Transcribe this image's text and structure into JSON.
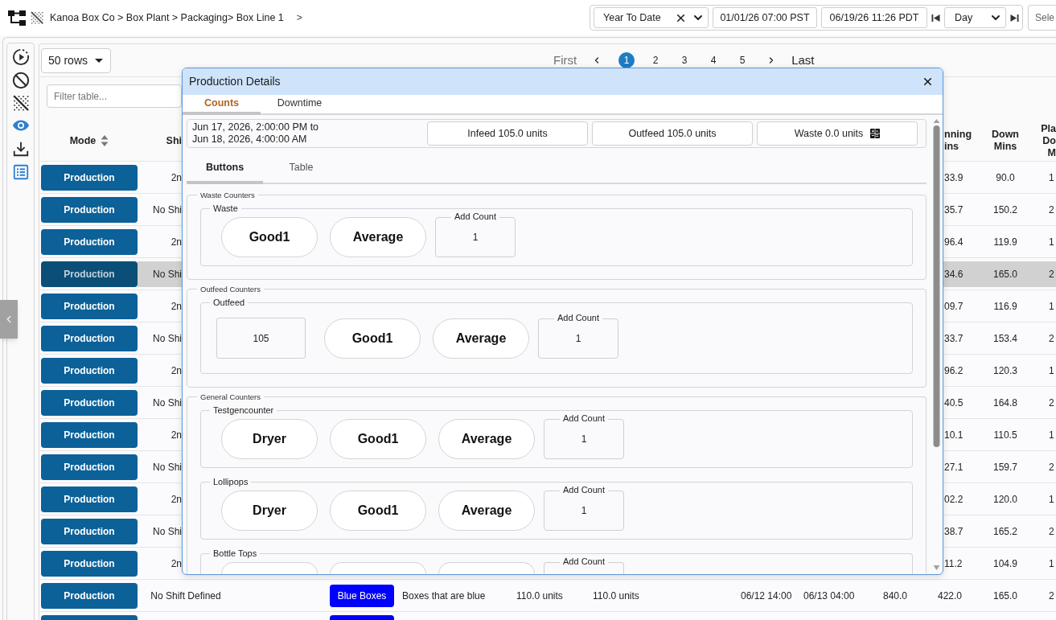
{
  "top_bar": {
    "breadcrumb": "Kanoa Box Co > Box Plant > Packaging> Box Line 1",
    "breadcrumb_next": ">",
    "range_select": "Year To Date",
    "start_time": "01/01/26 07:00 PST",
    "end_time": "06/19/26 11:26 PDT",
    "interval_select": "Day",
    "select_field": {
      "placeholder": "Sele"
    }
  },
  "toolbar": [
    {
      "active": false
    },
    {
      "active": false
    },
    {
      "active": false
    },
    {
      "active": true
    },
    {
      "active": false
    },
    {
      "active": true
    }
  ],
  "rows_select": "50 rows",
  "pagination": {
    "first": {
      "label": "First",
      "disabled": true
    },
    "pages": [
      {
        "label": "1",
        "selected": true
      },
      {
        "label": "2",
        "selected": false
      },
      {
        "label": "3",
        "selected": false
      },
      {
        "label": "4",
        "selected": false
      },
      {
        "label": "5",
        "selected": false
      }
    ],
    "last": {
      "label": "Last",
      "disabled": false
    }
  },
  "filter": {
    "placeholder": "Filter table..."
  },
  "table": {
    "columns": [
      {
        "label": "Mode",
        "sortable": true
      },
      {
        "label": "Shi",
        "sortable": false
      },
      {
        "label": "nning\nins",
        "sortable": false
      },
      {
        "label": "Down\nMins",
        "sortable": false
      },
      {
        "label": "Pla\nDo\nM",
        "sortable": false
      }
    ],
    "rows": [
      {
        "kind": "partial",
        "selected": false,
        "mode": "Production",
        "shift": "2n",
        "values": [
          "33.9",
          "90.0",
          "1"
        ]
      },
      {
        "kind": "partial",
        "selected": false,
        "mode": "Production",
        "shift": "No Shi",
        "values": [
          "35.7",
          "150.2",
          "2"
        ]
      },
      {
        "kind": "partial",
        "selected": false,
        "mode": "Production",
        "shift": "2n",
        "values": [
          "96.4",
          "119.9",
          "1"
        ]
      },
      {
        "kind": "partial",
        "selected": true,
        "mode": "Production",
        "shift": "No Shi",
        "values": [
          "34.6",
          "165.0",
          "2"
        ]
      },
      {
        "kind": "partial",
        "selected": false,
        "mode": "Production",
        "shift": "2n",
        "values": [
          "09.7",
          "116.9",
          "1"
        ]
      },
      {
        "kind": "partial",
        "selected": false,
        "mode": "Production",
        "shift": "No Shi",
        "values": [
          "33.7",
          "153.4",
          "2"
        ]
      },
      {
        "kind": "partial",
        "selected": false,
        "mode": "Production",
        "shift": "2n",
        "values": [
          "96.2",
          "120.3",
          "1"
        ]
      },
      {
        "kind": "partial",
        "selected": false,
        "mode": "Production",
        "shift": "No Shi",
        "values": [
          "40.5",
          "164.8",
          "2"
        ]
      },
      {
        "kind": "partial",
        "selected": false,
        "mode": "Production",
        "shift": "2n",
        "values": [
          "10.1",
          "110.5",
          "1"
        ]
      },
      {
        "kind": "partial",
        "selected": false,
        "mode": "Production",
        "shift": "No Shi",
        "values": [
          "27.1",
          "159.7",
          "2"
        ]
      },
      {
        "kind": "partial",
        "selected": false,
        "mode": "Production",
        "shift": "2n",
        "values": [
          "02.2",
          "120.0",
          "1"
        ]
      },
      {
        "kind": "partial",
        "selected": false,
        "mode": "Production",
        "shift": "No Shi",
        "values": [
          "38.7",
          "165.2",
          "2"
        ]
      },
      {
        "kind": "partial",
        "selected": false,
        "mode": "Production",
        "shift": "2n",
        "values": [
          "11.2",
          "104.9",
          "1"
        ]
      },
      {
        "kind": "full",
        "selected": false,
        "mode": "Production",
        "shift": "No Shift Defined",
        "tag": {
          "label": "Blue Boxes",
          "color": "#0000ff"
        },
        "values": [
          "Boxes that are blue",
          "110.0 units",
          "110.0 units",
          "06/12 14:00",
          "06/13 04:00",
          "840.0",
          "422.0",
          "165.0",
          "2"
        ]
      },
      {
        "kind": "cut",
        "selected": false,
        "tag": {
          "color": "#0000ff"
        }
      }
    ]
  },
  "dialog": {
    "title": "Production Details",
    "tabs": [
      {
        "label": "Counts",
        "selected": true
      },
      {
        "label": "Downtime",
        "selected": false
      }
    ],
    "summary": {
      "range": [
        "Jun 17, 2026, 2:00:00 PM to",
        "Jun 18, 2026, 4:00:00 AM"
      ],
      "totals": [
        {
          "label": "Infeed 105.0 units",
          "kind": "plain"
        },
        {
          "label": "Outfeed 105.0 units",
          "kind": "plain"
        },
        {
          "label": "Waste 0.0 units",
          "kind": "adjustable"
        }
      ]
    },
    "subtabs": [
      {
        "label": "Buttons",
        "selected": true
      },
      {
        "label": "Table",
        "selected": false
      }
    ],
    "sections": [
      {
        "title": "Waste Counters",
        "groups": [
          {
            "title": "Waste",
            "clipped": false,
            "items": [
              {
                "kind": "pill",
                "label": "Good1"
              },
              {
                "kind": "pill",
                "label": "Average"
              },
              {
                "kind": "add_count",
                "legend": "Add Count",
                "value": "1"
              }
            ]
          }
        ]
      },
      {
        "title": "Outfeed Counters",
        "groups": [
          {
            "title": "Outfeed",
            "clipped": false,
            "items": [
              {
                "kind": "display",
                "value": "105"
              },
              {
                "kind": "pill",
                "label": "Good1"
              },
              {
                "kind": "pill",
                "label": "Average"
              },
              {
                "kind": "add_count",
                "legend": "Add Count",
                "value": "1"
              }
            ]
          }
        ]
      },
      {
        "title": "General Counters",
        "groups": [
          {
            "title": "Testgencounter",
            "clipped": false,
            "items": [
              {
                "kind": "pill",
                "label": "Dryer"
              },
              {
                "kind": "pill",
                "label": "Good1"
              },
              {
                "kind": "pill",
                "label": "Average"
              },
              {
                "kind": "add_count",
                "legend": "Add Count",
                "value": "1"
              }
            ]
          },
          {
            "title": "Lollipops",
            "clipped": false,
            "items": [
              {
                "kind": "pill",
                "label": "Dryer"
              },
              {
                "kind": "pill",
                "label": "Good1"
              },
              {
                "kind": "pill",
                "label": "Average"
              },
              {
                "kind": "add_count",
                "legend": "Add Count",
                "value": "1"
              }
            ]
          },
          {
            "title": "Bottle Tops",
            "clipped": true,
            "items": [
              {
                "kind": "pill"
              },
              {
                "kind": "pill"
              },
              {
                "kind": "pill"
              },
              {
                "kind": "add_count",
                "legend": "Add Count"
              }
            ]
          }
        ]
      }
    ]
  }
}
